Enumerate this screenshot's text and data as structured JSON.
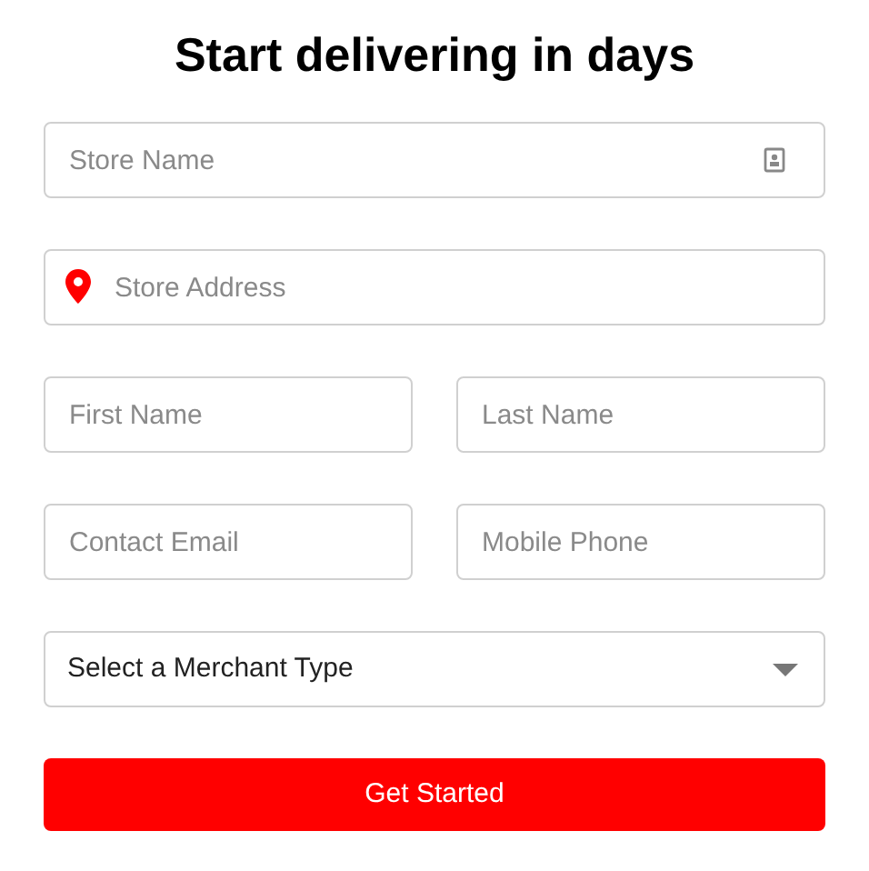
{
  "title": "Start delivering in days",
  "store_name": {
    "placeholder": "Store Name"
  },
  "store_address": {
    "placeholder": "Store Address"
  },
  "name_fields": [
    {
      "placeholder": "First Name"
    },
    {
      "placeholder": "Last Name"
    }
  ],
  "contact_fields": [
    {
      "placeholder": "Contact Email"
    },
    {
      "placeholder": "Mobile Phone"
    }
  ],
  "merchant_type": {
    "value": "Select a Merchant Type"
  },
  "submit_button": {
    "label": "Get Started"
  }
}
